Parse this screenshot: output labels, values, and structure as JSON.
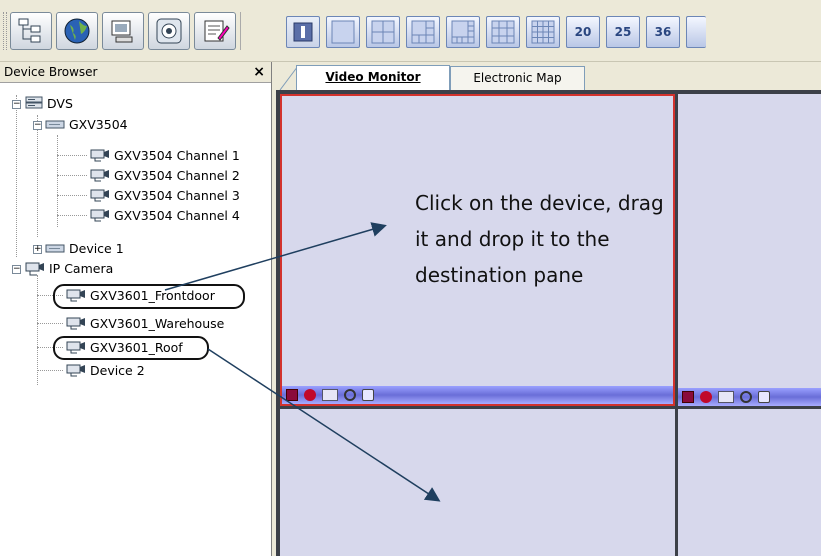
{
  "toolbar": {
    "tools": [
      {
        "name": "device-tree-icon"
      },
      {
        "name": "globe-icon"
      },
      {
        "name": "monitor-icon"
      },
      {
        "name": "ptz-control-icon"
      },
      {
        "name": "notepad-icon"
      }
    ],
    "layouts": [
      "",
      "",
      "",
      "",
      "",
      "",
      "",
      "20",
      "25",
      "36"
    ]
  },
  "sidebar": {
    "title": "Device Browser",
    "close": "×",
    "tree": {
      "dvs": "DVS",
      "gxv3504": "GXV3504",
      "channels": [
        "GXV3504 Channel 1",
        "GXV3504 Channel 2",
        "GXV3504 Channel 3",
        "GXV3504 Channel 4"
      ],
      "device1": "Device 1",
      "ip_camera": "IP Camera",
      "cameras": [
        "GXV3601_Frontdoor",
        "GXV3601_Warehouse",
        "GXV3601_Roof",
        "Device 2"
      ]
    }
  },
  "tabs": [
    "Video Monitor",
    "Electronic Map"
  ],
  "annotation": {
    "lines": [
      "Click on the device, drag",
      "it and drop it to the",
      "destination pane"
    ]
  },
  "colors": {
    "selected_pane_border": "#d2322d",
    "pane_bg": "#d7d8ec",
    "pane_bar": "#7a7ee6",
    "grid_line": "#3c4048"
  }
}
